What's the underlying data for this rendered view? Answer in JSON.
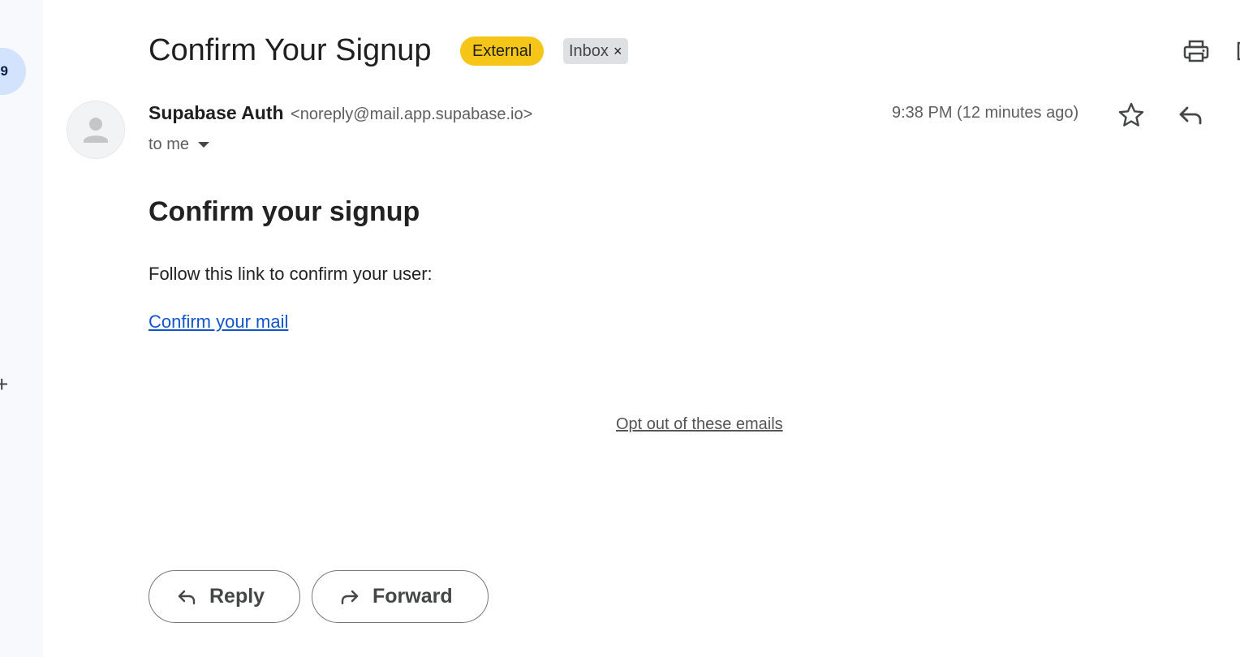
{
  "rail": {
    "count": "9",
    "plus": "+"
  },
  "header": {
    "subject": "Confirm Your Signup",
    "labels": {
      "external": "External",
      "inbox": "Inbox",
      "remove_symbol": "×"
    },
    "colors": {
      "external_chip": "#f5c518",
      "inbox_chip": "#dde1e4"
    }
  },
  "sender": {
    "name": "Supabase Auth",
    "email": "<noreply@mail.app.supabase.io>",
    "recipient": "to me",
    "timestamp": "9:38 PM (12 minutes ago)"
  },
  "message": {
    "heading": "Confirm your signup",
    "text": "Follow this link to confirm your user:",
    "confirm_link": "Confirm your mail",
    "optout_link": "Opt out of these emails",
    "link_color": "#1155cc"
  },
  "actions": {
    "reply": "Reply",
    "forward": "Forward"
  },
  "icons": [
    "print-icon",
    "open-new-window-icon",
    "person-icon",
    "dropdown-arrow-icon",
    "star-icon",
    "reply-icon",
    "forward-icon"
  ]
}
